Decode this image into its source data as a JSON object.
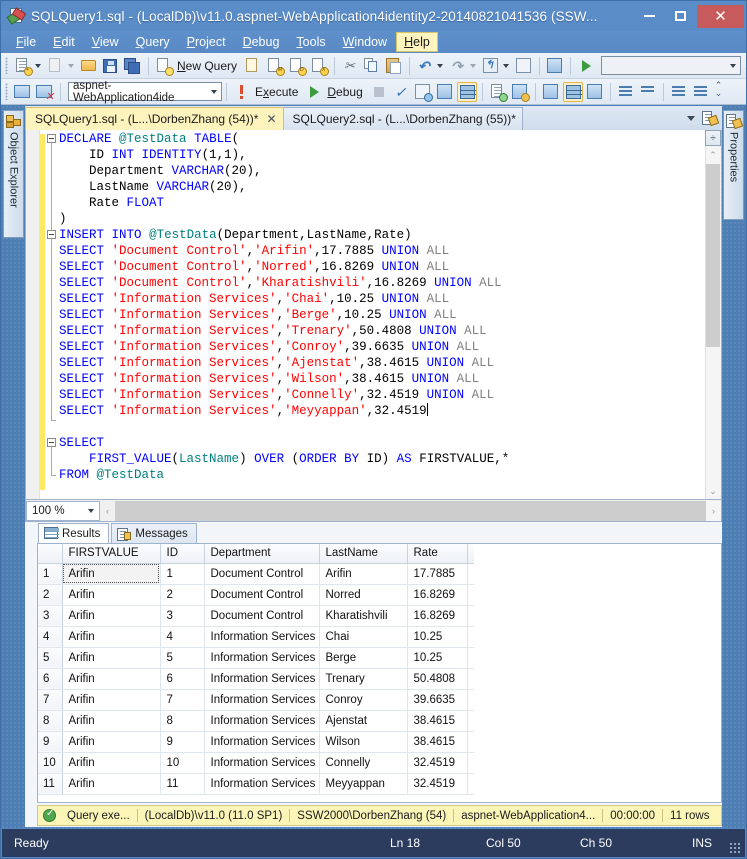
{
  "window": {
    "title": "SQLQuery1.sql - (LocalDb)\\v11.0.aspnet-WebApplication4identity2-20140821041536 (SSW...",
    "icon": "sql-query-file-icon",
    "minimize": "minimize-icon",
    "maximize": "maximize-icon",
    "close": "✕",
    "close_color": "#c75b5b"
  },
  "menu": {
    "items": [
      {
        "label": "File",
        "accel": "F",
        "active": false
      },
      {
        "label": "Edit",
        "accel": "E",
        "active": false
      },
      {
        "label": "View",
        "accel": "V",
        "active": false
      },
      {
        "label": "Query",
        "accel": "Q",
        "active": false
      },
      {
        "label": "Project",
        "accel": "P",
        "active": false
      },
      {
        "label": "Debug",
        "accel": "D",
        "active": false
      },
      {
        "label": "Tools",
        "accel": "T",
        "active": false
      },
      {
        "label": "Window",
        "accel": "W",
        "active": false
      },
      {
        "label": "Help",
        "accel": "H",
        "active": true
      }
    ]
  },
  "toolbar1": {
    "new_query_label": "New Query",
    "new_query_accel": "N",
    "icons": [
      "new-item-icon",
      "new-project-icon",
      "open-file-icon",
      "save-icon",
      "save-all-icon",
      "new-query-icon",
      "new-analysis-query-icon",
      "new-mdx-query-icon",
      "new-dmx-query-icon",
      "new-xmla-query-icon",
      "cut-icon",
      "copy-icon",
      "paste-icon",
      "undo-icon",
      "redo-icon",
      "navigate-backward-icon",
      "navigate-forward-icon",
      "object-explorer-icon",
      "start-debug-icon"
    ],
    "find_combo_value": ""
  },
  "toolbar2": {
    "database_combo_value": "aspnet-WebApplication4ide",
    "execute_label": "Execute",
    "execute_accel": "x",
    "debug_label": "Debug",
    "debug_accel": "D",
    "icons": [
      "connect-icon",
      "disconnect-icon",
      "execute-icon",
      "debug-icon",
      "stop-icon",
      "parse-icon",
      "display-estimated-plan-icon",
      "query-options-icon",
      "results-to-grid-icon",
      "results-to-text-icon",
      "results-to-file-icon",
      "include-actual-plan-icon",
      "include-client-statistics-icon",
      "comment-icon",
      "uncomment-icon",
      "decrease-indent-icon",
      "increase-indent-icon"
    ]
  },
  "docked_tabs": {
    "left": {
      "label": "Object Explorer",
      "icon": "object-explorer-icon"
    },
    "right": {
      "label": "Properties",
      "icon": "properties-icon"
    }
  },
  "document_tabs": [
    {
      "label": "SQLQuery1.sql - (L...\\DorbenZhang (54))*",
      "active": true,
      "closable": true
    },
    {
      "label": "SQLQuery2.sql - (L...\\DorbenZhang (55))*",
      "active": false,
      "closable": false
    }
  ],
  "editor": {
    "zoom": "100 %",
    "lines": [
      [
        {
          "t": "DECLARE",
          "c": "kw"
        },
        {
          "t": " ",
          "c": "blk"
        },
        {
          "t": "@TestData",
          "c": "tv"
        },
        {
          "t": " ",
          "c": "blk"
        },
        {
          "t": "TABLE",
          "c": "kw"
        },
        {
          "t": "(",
          "c": "blk"
        }
      ],
      [
        {
          "t": "    ID ",
          "c": "blk"
        },
        {
          "t": "INT",
          "c": "kw"
        },
        {
          "t": " ",
          "c": "blk"
        },
        {
          "t": "IDENTITY",
          "c": "kw"
        },
        {
          "t": "(1,1),",
          "c": "blk"
        }
      ],
      [
        {
          "t": "    Department ",
          "c": "blk"
        },
        {
          "t": "VARCHAR",
          "c": "kw"
        },
        {
          "t": "(20),",
          "c": "blk"
        }
      ],
      [
        {
          "t": "    LastName ",
          "c": "blk"
        },
        {
          "t": "VARCHAR",
          "c": "kw"
        },
        {
          "t": "(20),",
          "c": "blk"
        }
      ],
      [
        {
          "t": "    Rate ",
          "c": "blk"
        },
        {
          "t": "FLOAT",
          "c": "kw"
        }
      ],
      [
        {
          "t": ")",
          "c": "blk"
        }
      ],
      [
        {
          "t": "INSERT",
          "c": "kw"
        },
        {
          "t": " ",
          "c": "blk"
        },
        {
          "t": "INTO",
          "c": "kw"
        },
        {
          "t": " ",
          "c": "blk"
        },
        {
          "t": "@TestData",
          "c": "tv"
        },
        {
          "t": "(Department,LastName,Rate)",
          "c": "blk"
        }
      ],
      [
        {
          "t": "SELECT",
          "c": "kw"
        },
        {
          "t": " ",
          "c": "blk"
        },
        {
          "t": "'Document Control'",
          "c": "str"
        },
        {
          "t": ",",
          "c": "blk"
        },
        {
          "t": "'Arifin'",
          "c": "str"
        },
        {
          "t": ",17.7885 ",
          "c": "blk"
        },
        {
          "t": "UNION",
          "c": "kw"
        },
        {
          "t": " ",
          "c": "blk"
        },
        {
          "t": "ALL",
          "c": "gr"
        }
      ],
      [
        {
          "t": "SELECT",
          "c": "kw"
        },
        {
          "t": " ",
          "c": "blk"
        },
        {
          "t": "'Document Control'",
          "c": "str"
        },
        {
          "t": ",",
          "c": "blk"
        },
        {
          "t": "'Norred'",
          "c": "str"
        },
        {
          "t": ",16.8269 ",
          "c": "blk"
        },
        {
          "t": "UNION",
          "c": "kw"
        },
        {
          "t": " ",
          "c": "blk"
        },
        {
          "t": "ALL",
          "c": "gr"
        }
      ],
      [
        {
          "t": "SELECT",
          "c": "kw"
        },
        {
          "t": " ",
          "c": "blk"
        },
        {
          "t": "'Document Control'",
          "c": "str"
        },
        {
          "t": ",",
          "c": "blk"
        },
        {
          "t": "'Kharatishvili'",
          "c": "str"
        },
        {
          "t": ",16.8269 ",
          "c": "blk"
        },
        {
          "t": "UNION",
          "c": "kw"
        },
        {
          "t": " ",
          "c": "blk"
        },
        {
          "t": "ALL",
          "c": "gr"
        }
      ],
      [
        {
          "t": "SELECT",
          "c": "kw"
        },
        {
          "t": " ",
          "c": "blk"
        },
        {
          "t": "'Information Services'",
          "c": "str"
        },
        {
          "t": ",",
          "c": "blk"
        },
        {
          "t": "'Chai'",
          "c": "str"
        },
        {
          "t": ",10.25 ",
          "c": "blk"
        },
        {
          "t": "UNION",
          "c": "kw"
        },
        {
          "t": " ",
          "c": "blk"
        },
        {
          "t": "ALL",
          "c": "gr"
        }
      ],
      [
        {
          "t": "SELECT",
          "c": "kw"
        },
        {
          "t": " ",
          "c": "blk"
        },
        {
          "t": "'Information Services'",
          "c": "str"
        },
        {
          "t": ",",
          "c": "blk"
        },
        {
          "t": "'Berge'",
          "c": "str"
        },
        {
          "t": ",10.25 ",
          "c": "blk"
        },
        {
          "t": "UNION",
          "c": "kw"
        },
        {
          "t": " ",
          "c": "blk"
        },
        {
          "t": "ALL",
          "c": "gr"
        }
      ],
      [
        {
          "t": "SELECT",
          "c": "kw"
        },
        {
          "t": " ",
          "c": "blk"
        },
        {
          "t": "'Information Services'",
          "c": "str"
        },
        {
          "t": ",",
          "c": "blk"
        },
        {
          "t": "'Trenary'",
          "c": "str"
        },
        {
          "t": ",50.4808 ",
          "c": "blk"
        },
        {
          "t": "UNION",
          "c": "kw"
        },
        {
          "t": " ",
          "c": "blk"
        },
        {
          "t": "ALL",
          "c": "gr"
        }
      ],
      [
        {
          "t": "SELECT",
          "c": "kw"
        },
        {
          "t": " ",
          "c": "blk"
        },
        {
          "t": "'Information Services'",
          "c": "str"
        },
        {
          "t": ",",
          "c": "blk"
        },
        {
          "t": "'Conroy'",
          "c": "str"
        },
        {
          "t": ",39.6635 ",
          "c": "blk"
        },
        {
          "t": "UNION",
          "c": "kw"
        },
        {
          "t": " ",
          "c": "blk"
        },
        {
          "t": "ALL",
          "c": "gr"
        }
      ],
      [
        {
          "t": "SELECT",
          "c": "kw"
        },
        {
          "t": " ",
          "c": "blk"
        },
        {
          "t": "'Information Services'",
          "c": "str"
        },
        {
          "t": ",",
          "c": "blk"
        },
        {
          "t": "'Ajenstat'",
          "c": "str"
        },
        {
          "t": ",38.4615 ",
          "c": "blk"
        },
        {
          "t": "UNION",
          "c": "kw"
        },
        {
          "t": " ",
          "c": "blk"
        },
        {
          "t": "ALL",
          "c": "gr"
        }
      ],
      [
        {
          "t": "SELECT",
          "c": "kw"
        },
        {
          "t": " ",
          "c": "blk"
        },
        {
          "t": "'Information Services'",
          "c": "str"
        },
        {
          "t": ",",
          "c": "blk"
        },
        {
          "t": "'Wilson'",
          "c": "str"
        },
        {
          "t": ",38.4615 ",
          "c": "blk"
        },
        {
          "t": "UNION",
          "c": "kw"
        },
        {
          "t": " ",
          "c": "blk"
        },
        {
          "t": "ALL",
          "c": "gr"
        }
      ],
      [
        {
          "t": "SELECT",
          "c": "kw"
        },
        {
          "t": " ",
          "c": "blk"
        },
        {
          "t": "'Information Services'",
          "c": "str"
        },
        {
          "t": ",",
          "c": "blk"
        },
        {
          "t": "'Connelly'",
          "c": "str"
        },
        {
          "t": ",32.4519 ",
          "c": "blk"
        },
        {
          "t": "UNION",
          "c": "kw"
        },
        {
          "t": " ",
          "c": "blk"
        },
        {
          "t": "ALL",
          "c": "gr"
        }
      ],
      [
        {
          "t": "SELECT",
          "c": "kw"
        },
        {
          "t": " ",
          "c": "blk"
        },
        {
          "t": "'Information Services'",
          "c": "str"
        },
        {
          "t": ",",
          "c": "blk"
        },
        {
          "t": "'Meyyappan'",
          "c": "str"
        },
        {
          "t": ",32.4519",
          "c": "blk"
        },
        {
          "t": "|",
          "c": "caret"
        }
      ],
      [],
      [
        {
          "t": "SELECT",
          "c": "kw"
        }
      ],
      [
        {
          "t": "    ",
          "c": "blk"
        },
        {
          "t": "FIRST_VALUE",
          "c": "kw"
        },
        {
          "t": "(",
          "c": "blk"
        },
        {
          "t": "LastName",
          "c": "tv"
        },
        {
          "t": ") ",
          "c": "blk"
        },
        {
          "t": "OVER",
          "c": "kw"
        },
        {
          "t": " (",
          "c": "blk"
        },
        {
          "t": "ORDER",
          "c": "kw"
        },
        {
          "t": " ",
          "c": "blk"
        },
        {
          "t": "BY",
          "c": "kw"
        },
        {
          "t": " ID) ",
          "c": "blk"
        },
        {
          "t": "AS",
          "c": "kw"
        },
        {
          "t": " FIRSTVALUE,*",
          "c": "blk"
        }
      ],
      [
        {
          "t": "FROM",
          "c": "kw"
        },
        {
          "t": " ",
          "c": "blk"
        },
        {
          "t": "@TestData",
          "c": "tv"
        }
      ]
    ]
  },
  "results": {
    "tabs": [
      {
        "label": "Results",
        "icon": "results-grid-icon",
        "active": true
      },
      {
        "label": "Messages",
        "icon": "messages-icon",
        "active": false
      }
    ],
    "columns": [
      "FIRSTVALUE",
      "ID",
      "Department",
      "LastName",
      "Rate"
    ],
    "rows": [
      {
        "n": "1",
        "cells": [
          "Arifin",
          "1",
          "Document Control",
          "Arifin",
          "17.7885"
        ]
      },
      {
        "n": "2",
        "cells": [
          "Arifin",
          "2",
          "Document Control",
          "Norred",
          "16.8269"
        ]
      },
      {
        "n": "3",
        "cells": [
          "Arifin",
          "3",
          "Document Control",
          "Kharatishvili",
          "16.8269"
        ]
      },
      {
        "n": "4",
        "cells": [
          "Arifin",
          "4",
          "Information Services",
          "Chai",
          "10.25"
        ]
      },
      {
        "n": "5",
        "cells": [
          "Arifin",
          "5",
          "Information Services",
          "Berge",
          "10.25"
        ]
      },
      {
        "n": "6",
        "cells": [
          "Arifin",
          "6",
          "Information Services",
          "Trenary",
          "50.4808"
        ]
      },
      {
        "n": "7",
        "cells": [
          "Arifin",
          "7",
          "Information Services",
          "Conroy",
          "39.6635"
        ]
      },
      {
        "n": "8",
        "cells": [
          "Arifin",
          "8",
          "Information Services",
          "Ajenstat",
          "38.4615"
        ]
      },
      {
        "n": "9",
        "cells": [
          "Arifin",
          "9",
          "Information Services",
          "Wilson",
          "38.4615"
        ]
      },
      {
        "n": "10",
        "cells": [
          "Arifin",
          "10",
          "Information Services",
          "Connelly",
          "32.4519"
        ]
      },
      {
        "n": "11",
        "cells": [
          "Arifin",
          "11",
          "Information Services",
          "Meyyappan",
          "32.4519"
        ]
      }
    ]
  },
  "query_status": {
    "state_icon": "success-check-icon",
    "state": "Query exe...",
    "server": "(LocalDb)\\v11.0 (11.0 SP1)",
    "user": "SSW2000\\DorbenZhang (54)",
    "database": "aspnet-WebApplication4...",
    "elapsed": "00:00:00",
    "rowcount": "11 rows"
  },
  "statusbar": {
    "ready": "Ready",
    "line": "Ln 18",
    "col": "Col 50",
    "ch": "Ch 50",
    "insert_mode": "INS"
  }
}
